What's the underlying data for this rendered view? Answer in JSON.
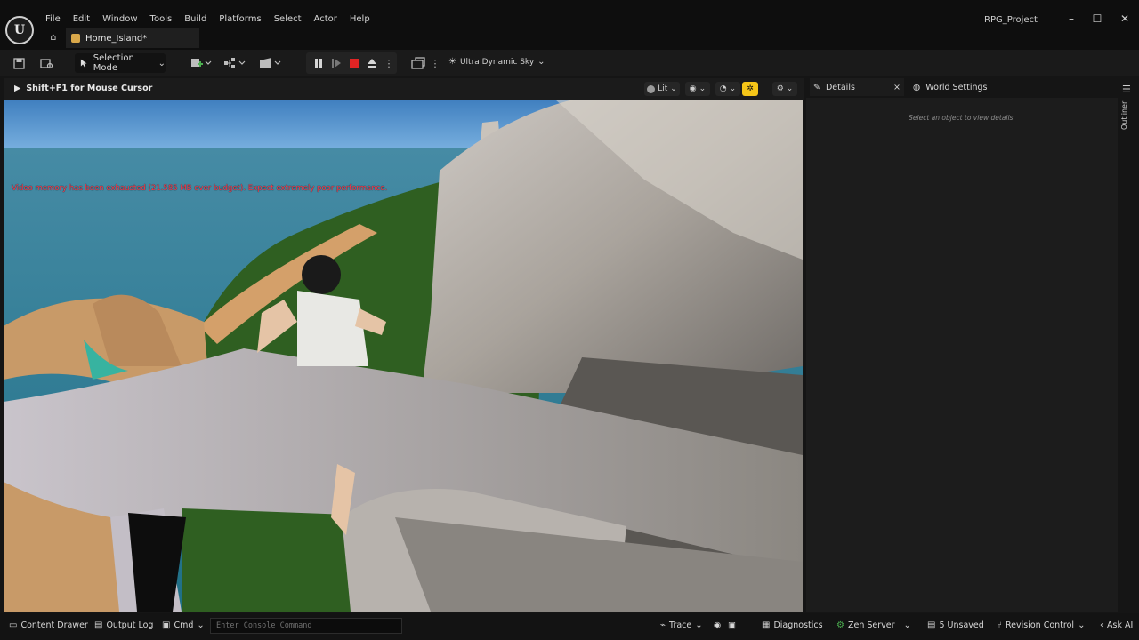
{
  "app": {
    "project_name": "RPG_Project",
    "logo_text": "U"
  },
  "menu": [
    "File",
    "Edit",
    "Window",
    "Tools",
    "Build",
    "Platforms",
    "Select",
    "Actor",
    "Help"
  ],
  "tab": {
    "label": "Home_Island*"
  },
  "toolbar": {
    "selection_mode": "Selection Mode",
    "sky_label": "Ultra Dynamic Sky"
  },
  "viewport": {
    "hint": "Shift+F1 for Mouse Cursor",
    "view_mode": "Lit",
    "warning": "Video memory has been exhausted (21.585 MB over budget). Expect extremely poor performance."
  },
  "panels": {
    "details_tab": "Details",
    "world_settings_tab": "World Settings",
    "details_hint": "Select an object to view details.",
    "outliner_label": "Outliner"
  },
  "status": {
    "content_drawer": "Content Drawer",
    "output_log": "Output Log",
    "cmd": "Cmd",
    "console_placeholder": "Enter Console Command",
    "trace": "Trace",
    "diagnostics": "Diagnostics",
    "zen_server": "Zen Server",
    "unsaved": "5 Unsaved",
    "revision_control": "Revision Control",
    "ask_ai": "Ask AI"
  },
  "colors": {
    "accent_yellow": "#f5c518",
    "stop_red": "#e02424",
    "warning_red": "#ff3b4d"
  }
}
